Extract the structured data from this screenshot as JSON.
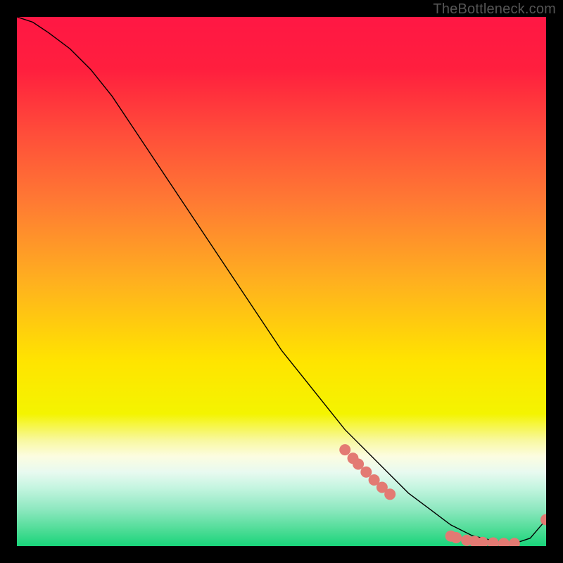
{
  "watermark": "TheBottleneck.com",
  "chart_data": {
    "type": "line",
    "title": "",
    "xlabel": "",
    "ylabel": "",
    "xlim": [
      0,
      100
    ],
    "ylim": [
      0,
      100
    ],
    "series": [
      {
        "name": "curve",
        "x": [
          0,
          3,
          6,
          10,
          14,
          18,
          22,
          26,
          30,
          34,
          38,
          42,
          46,
          50,
          54,
          58,
          62,
          66,
          70,
          74,
          78,
          82,
          86,
          90,
          94,
          97,
          100
        ],
        "y": [
          100,
          99,
          97,
          94,
          90,
          85,
          79,
          73,
          67,
          61,
          55,
          49,
          43,
          37,
          32,
          27,
          22,
          18,
          14,
          10,
          7,
          4,
          2,
          1,
          0.5,
          1.5,
          5
        ]
      }
    ],
    "scatter": [
      {
        "x": 62.0,
        "y": 18.2
      },
      {
        "x": 63.5,
        "y": 16.6
      },
      {
        "x": 64.5,
        "y": 15.5
      },
      {
        "x": 66.0,
        "y": 14.0
      },
      {
        "x": 67.5,
        "y": 12.5
      },
      {
        "x": 69.0,
        "y": 11.1
      },
      {
        "x": 70.5,
        "y": 9.8
      },
      {
        "x": 82.0,
        "y": 1.9
      },
      {
        "x": 83.0,
        "y": 1.6
      },
      {
        "x": 85.0,
        "y": 1.1
      },
      {
        "x": 86.5,
        "y": 0.9
      },
      {
        "x": 88.0,
        "y": 0.7
      },
      {
        "x": 90.0,
        "y": 0.6
      },
      {
        "x": 92.0,
        "y": 0.5
      },
      {
        "x": 94.0,
        "y": 0.5
      },
      {
        "x": 100.0,
        "y": 5.0
      }
    ],
    "gradient_stops": [
      {
        "offset": 0.0,
        "color": "#ff1744"
      },
      {
        "offset": 0.1,
        "color": "#ff1f3e"
      },
      {
        "offset": 0.22,
        "color": "#ff4d3a"
      },
      {
        "offset": 0.35,
        "color": "#ff7a33"
      },
      {
        "offset": 0.5,
        "color": "#ffb01f"
      },
      {
        "offset": 0.65,
        "color": "#ffe400"
      },
      {
        "offset": 0.75,
        "color": "#f4f400"
      },
      {
        "offset": 0.8,
        "color": "#f8f8a0"
      },
      {
        "offset": 0.83,
        "color": "#fcfce0"
      },
      {
        "offset": 0.86,
        "color": "#e8faf0"
      },
      {
        "offset": 0.89,
        "color": "#c4f5e0"
      },
      {
        "offset": 0.93,
        "color": "#8ee8c0"
      },
      {
        "offset": 0.97,
        "color": "#4ddc96"
      },
      {
        "offset": 1.0,
        "color": "#18d47a"
      }
    ],
    "marker_color": "#e37a73",
    "marker_radius": 8,
    "line_color": "#000000",
    "line_width": 1.4
  }
}
